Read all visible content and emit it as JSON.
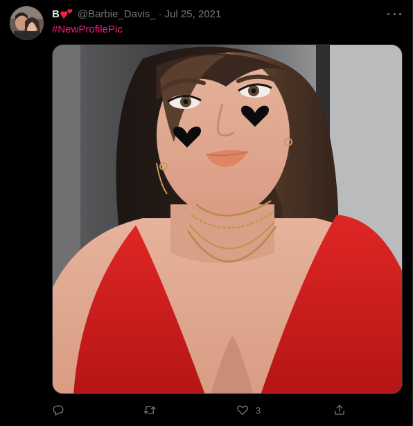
{
  "tweet": {
    "display_name": "B",
    "name_emoji": "two-hearts-emoji",
    "handle": "@Barbie_Davis_",
    "separator": "·",
    "date": "Jul 25, 2021",
    "hashtag": "#NewProfilePic",
    "more_icon": "more-dots-icon"
  },
  "actions": {
    "reply": {
      "icon": "reply-icon",
      "count": ""
    },
    "retweet": {
      "icon": "retweet-icon",
      "count": ""
    },
    "like": {
      "icon": "heart-icon",
      "count": "3"
    },
    "share": {
      "icon": "share-icon",
      "count": ""
    }
  },
  "colors": {
    "background": "#000000",
    "text": "#e7e9ea",
    "secondary": "#71767b",
    "hashtag": "#f91880",
    "emoji_red": "#f0243c",
    "dress_red": "#d81e1e"
  }
}
